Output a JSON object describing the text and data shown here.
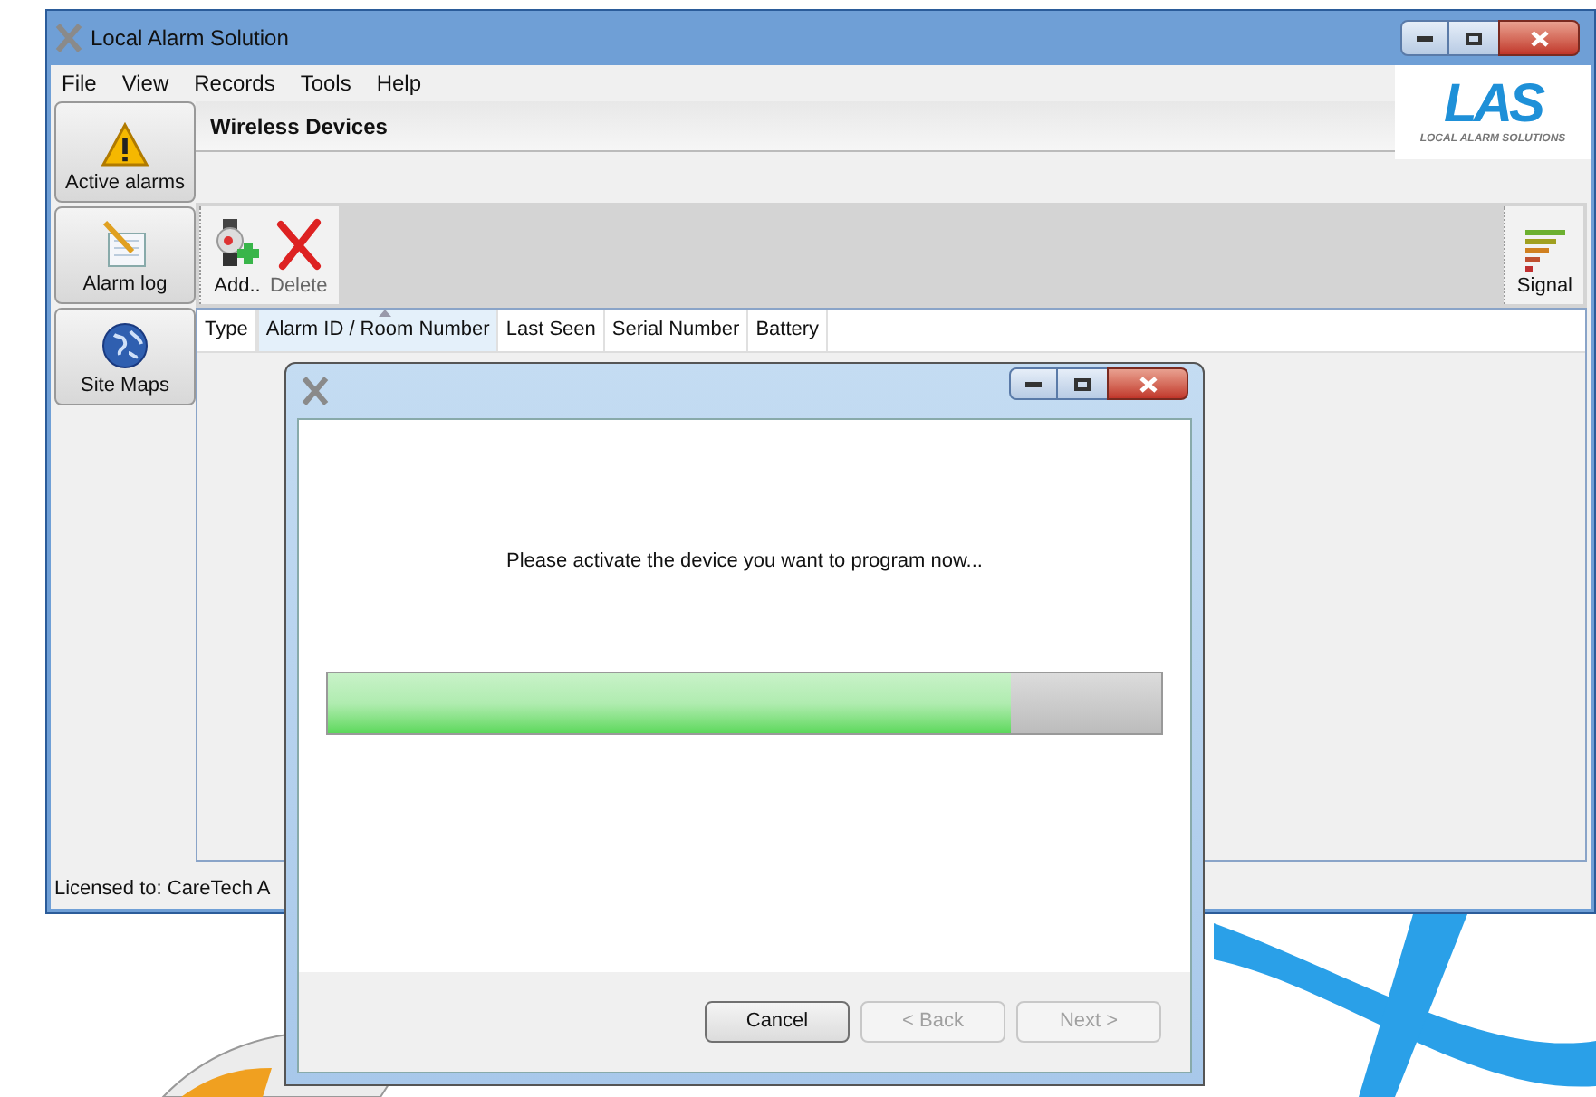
{
  "window": {
    "title": "Local Alarm Solution"
  },
  "menu": [
    "File",
    "View",
    "Records",
    "Tools",
    "Help"
  ],
  "logo": {
    "text": "LAS",
    "subtitle": "LOCAL ALARM SOLUTIONS"
  },
  "sidebar": {
    "items": [
      {
        "label": "Active alarms",
        "kind": "warning"
      },
      {
        "label": "Alarm log",
        "kind": "log"
      },
      {
        "label": "Site Maps",
        "kind": "globe"
      }
    ]
  },
  "section_title": "Wireless Devices",
  "toolbar": {
    "left": [
      {
        "label": "Add..",
        "kind": "add"
      },
      {
        "label": "Delete",
        "kind": "delete"
      }
    ],
    "right": [
      {
        "label": "Signal",
        "kind": "signal"
      }
    ]
  },
  "table": {
    "columns": [
      {
        "label": "Type",
        "sorted": false
      },
      {
        "label": "Alarm ID / Room Number",
        "sorted": true
      },
      {
        "label": "Last Seen",
        "sorted": false
      },
      {
        "label": "Serial Number",
        "sorted": false
      },
      {
        "label": "Battery",
        "sorted": false
      }
    ]
  },
  "status_bar": "Licensed to: CareTech A",
  "dialog": {
    "message": "Please activate the device you want to program now...",
    "progress": {
      "level": 0.82
    },
    "buttons": [
      {
        "label": "Cancel",
        "disabled": false
      },
      {
        "label": "< Back",
        "disabled": true
      },
      {
        "label": "Next >",
        "disabled": true
      }
    ]
  }
}
